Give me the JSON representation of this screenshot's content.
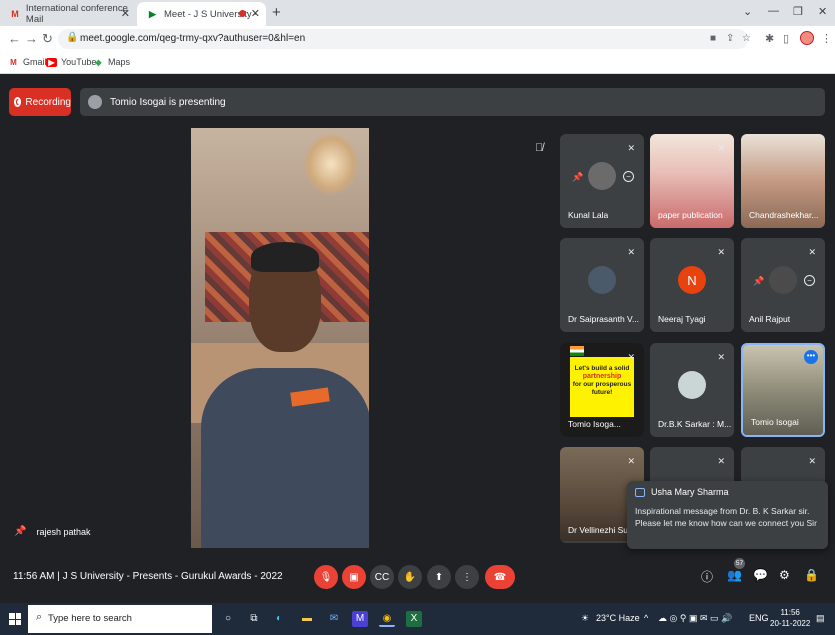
{
  "browser": {
    "tabs": [
      {
        "label": "International conference Mail"
      },
      {
        "label": "Meet - J S University - Presen"
      }
    ],
    "url": "meet.google.com/qeg-trmy-qxv?authuser=0&hl=en",
    "bookmarks": [
      {
        "label": "Gmail"
      },
      {
        "label": "YouTube"
      },
      {
        "label": "Maps"
      }
    ]
  },
  "meet": {
    "recording_label": "Recording",
    "presenting_text": "Tomio Isogai is presenting",
    "main_speaker": "rajesh pathak",
    "tiles": [
      {
        "name": "Kunal Lala"
      },
      {
        "name": "paper publication"
      },
      {
        "name": "Chandrashekhar..."
      },
      {
        "name": "Dr Saiprasanth V..."
      },
      {
        "name": "Neeraj Tyagi",
        "initial": "N"
      },
      {
        "name": "Anil Rajput"
      },
      {
        "name": "Tomio Isoga..."
      },
      {
        "name": "Dr.B.K Sarkar : M..."
      },
      {
        "name": "Tomio Isogai"
      },
      {
        "name": "Dr Vellinezhi Sul"
      }
    ],
    "slide_text": {
      "line1": "Let's build a solid",
      "line2": "partnership",
      "line3": "for our prosperous",
      "line4": "future!"
    },
    "chat_toast": {
      "sender": "Usha Mary Sharma",
      "message": "Inspirational message from Dr. B. K Sarkar sir. Please let me know how can we connect you Sir"
    },
    "bottom": {
      "time_title": "11:56 AM  |  J S University - Presents - Gurukul Awards - 2022",
      "participant_count": "57"
    }
  },
  "taskbar": {
    "search_placeholder": "Type here to search",
    "weather": "23°C  Haze",
    "language": "ENG",
    "time": "11:56",
    "date": "20-11-2022"
  }
}
